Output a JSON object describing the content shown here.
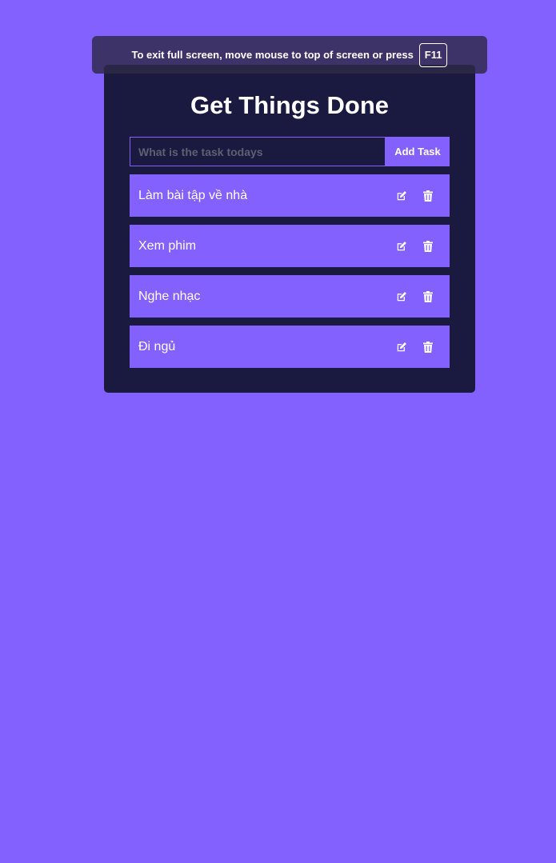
{
  "fullscreen_notice": {
    "text": "To exit full screen, move mouse to top of screen or press",
    "key": "F11"
  },
  "app": {
    "title": "Get Things Done",
    "input": {
      "placeholder": "What is the task todays",
      "value": ""
    },
    "add_button_label": "Add Task",
    "tasks": [
      {
        "text": "Làm bài tập về nhà",
        "edit_icon": "edit-icon",
        "delete_icon": "trash-icon"
      },
      {
        "text": "Xem phim",
        "edit_icon": "edit-icon",
        "delete_icon": "trash-icon"
      },
      {
        "text": "Nghe nhạc",
        "edit_icon": "edit-icon",
        "delete_icon": "trash-icon"
      },
      {
        "text": "Đi ngủ",
        "edit_icon": "edit-icon",
        "delete_icon": "trash-icon"
      }
    ]
  },
  "colors": {
    "background": "#8361fe",
    "card": "#1a1a40",
    "accent": "#8361fe",
    "text": "#ffffff"
  }
}
